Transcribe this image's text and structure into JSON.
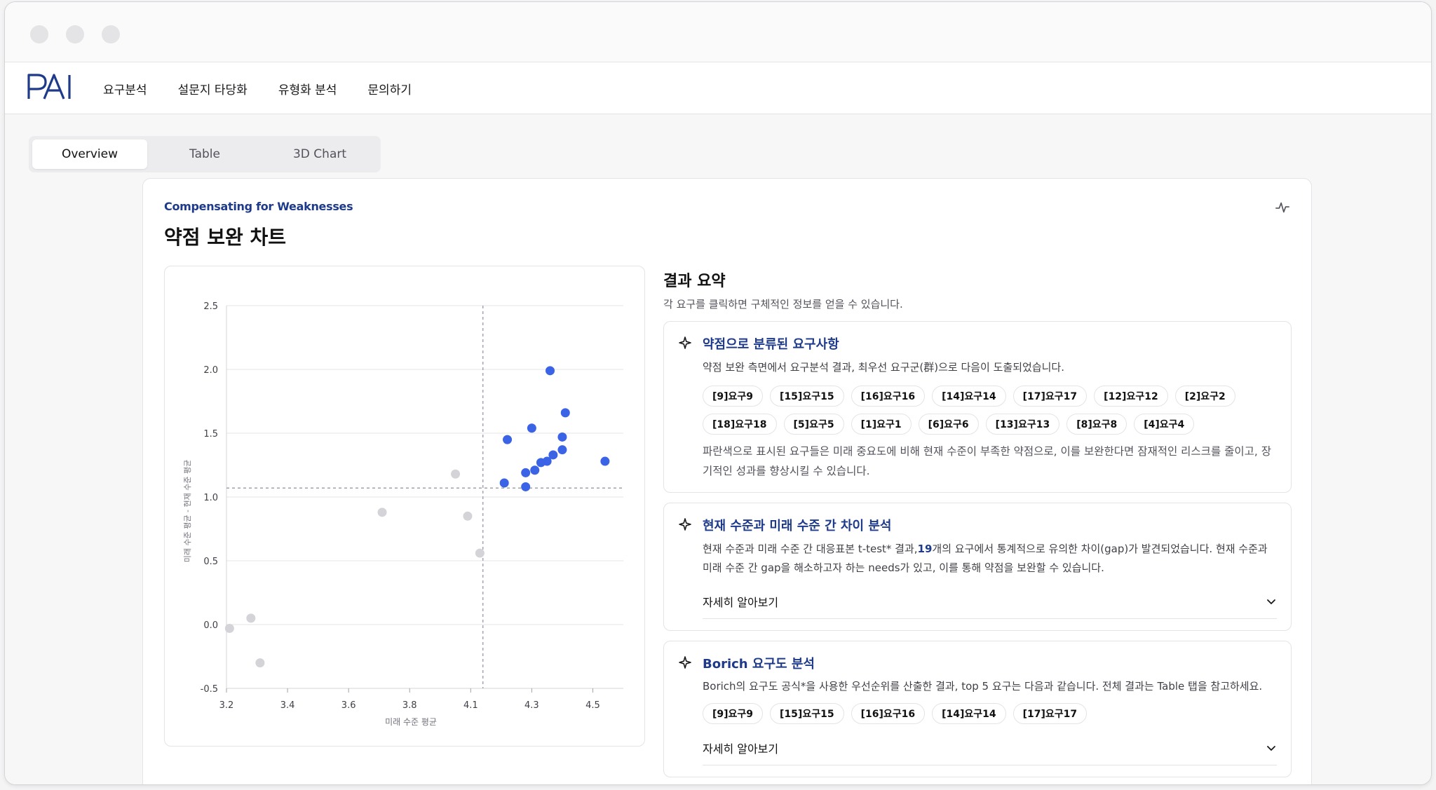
{
  "nav": {
    "logo_text": "PAI",
    "items": [
      "요구분석",
      "설문지 타당화",
      "유형화 분석",
      "문의하기"
    ]
  },
  "tabs": [
    "Overview",
    "Table",
    "3D Chart"
  ],
  "card": {
    "eyebrow": "Compensating for Weaknesses",
    "title": "약점 보완 차트"
  },
  "chart_data": {
    "type": "scatter",
    "xlabel": "미래 수준 평균",
    "ylabel": "미래 수준 평균 - 현재 수준 평균",
    "xlim": [
      3.2,
      4.5
    ],
    "ylim": [
      -0.5,
      2.5
    ],
    "x_ticks": [
      "3.2",
      "3.4",
      "3.6",
      "3.8",
      "4.1",
      "4.3",
      "4.5"
    ],
    "x_tick_values": [
      3.2,
      3.4,
      3.6,
      3.8,
      4.0,
      4.2,
      4.4
    ],
    "y_ticks": [
      "2.5",
      "2.0",
      "1.5",
      "1.0",
      "0.5",
      "0.0",
      "-0.5"
    ],
    "y_tick_values": [
      2.5,
      2.0,
      1.5,
      1.0,
      0.5,
      0.0,
      -0.5
    ],
    "x_threshold": 4.04,
    "y_threshold": 1.07,
    "colors": {
      "weakness": "#3b63e6",
      "other": "#d4d4d8"
    },
    "series": [
      {
        "color": "#3b63e6",
        "points": [
          [
            4.26,
            1.99
          ],
          [
            4.31,
            1.66
          ],
          [
            4.2,
            1.54
          ],
          [
            4.3,
            1.47
          ],
          [
            4.12,
            1.45
          ],
          [
            4.3,
            1.37
          ],
          [
            4.27,
            1.33
          ],
          [
            4.44,
            1.28
          ],
          [
            4.25,
            1.28
          ],
          [
            4.23,
            1.27
          ],
          [
            4.21,
            1.21
          ],
          [
            4.18,
            1.19
          ],
          [
            4.11,
            1.11
          ],
          [
            4.18,
            1.08
          ]
        ]
      },
      {
        "color": "#d4d4d8",
        "points": [
          [
            3.95,
            1.18
          ],
          [
            3.71,
            0.88
          ],
          [
            3.99,
            0.85
          ],
          [
            4.03,
            0.56
          ],
          [
            3.28,
            0.05
          ],
          [
            3.21,
            -0.03
          ],
          [
            3.31,
            -0.3
          ]
        ]
      }
    ]
  },
  "summary": {
    "title": "결과 요약",
    "subtitle": "각 요구를 클릭하면 구체적인 정보를 얻을 수 있습니다.",
    "sections": [
      {
        "title": "약점으로 분류된 요구사항",
        "desc": "약점 보완 측면에서 요구분석 결과, 최우선 요구군(群)으로 다음이 도출되었습니다.",
        "chips": [
          "[9]요구9",
          "[15]요구15",
          "[16]요구16",
          "[14]요구14",
          "[17]요구17",
          "[12]요구12",
          "[2]요구2",
          "[18]요구18",
          "[5]요구5",
          "[1]요구1",
          "[6]요구6",
          "[13]요구13",
          "[8]요구8",
          "[4]요구4"
        ],
        "note": "파란색으로 표시된 요구들은 미래 중요도에 비해 현재 수준이 부족한 약점으로, 이를 보완한다면 잠재적인 리스크를 줄이고, 장기적인 성과를 향상시킬 수 있습니다."
      },
      {
        "title": "현재 수준과 미래 수준 간 차이 분석",
        "desc_before": "현재 수준과 미래 수준 간 대응표본 t-test* 결과,",
        "desc_count": "19",
        "desc_after": "개의 요구에서 통계적으로 유의한 차이(gap)가 발견되었습니다. 현재 수준과 미래 수준 간 gap을 해소하고자 하는 needs가 있고, 이를 통해 약점을 보완할 수 있습니다.",
        "more": "자세히 알아보기"
      },
      {
        "title": "Borich 요구도 분석",
        "desc": "Borich의 요구도 공식*을 사용한 우선순위를 산출한 결과, top 5 요구는 다음과 같습니다. 전체 결과는 Table 탭을 참고하세요.",
        "chips": [
          "[9]요구9",
          "[15]요구15",
          "[16]요구16",
          "[14]요구14",
          "[17]요구17"
        ],
        "more": "자세히 알아보기"
      }
    ]
  }
}
